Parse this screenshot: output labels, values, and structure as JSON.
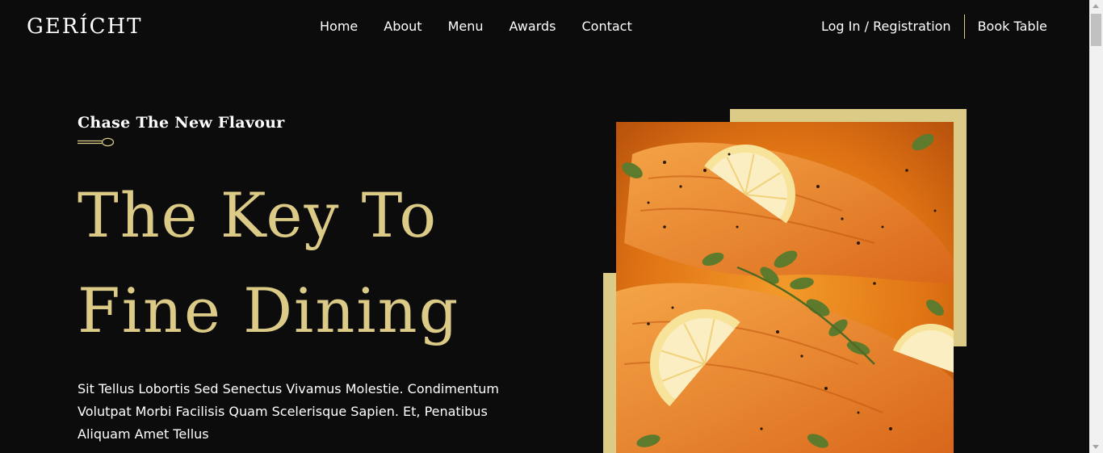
{
  "brand": {
    "logo": "GERÍCHT"
  },
  "nav": {
    "links": [
      {
        "label": "Home"
      },
      {
        "label": "About"
      },
      {
        "label": "Menu"
      },
      {
        "label": "Awards"
      },
      {
        "label": "Contact"
      }
    ],
    "login_label": "Log In / Registration",
    "book_label": "Book Table"
  },
  "hero": {
    "subtitle": "Chase The New Flavour",
    "headline_line1": "The Key To",
    "headline_line2": "Fine Dining",
    "description": "Sit Tellus Lobortis Sed Senectus Vivamus Molestie. Condimentum Volutpat Morbi Facilisis Quam Scelerisque Sapien. Et, Penatibus Aliquam Amet Tellus",
    "image_icon": "food-photo-salmon-lemon"
  },
  "colors": {
    "background": "#0c0c0c",
    "gold": "#dcca87",
    "text": "#ffffff"
  }
}
